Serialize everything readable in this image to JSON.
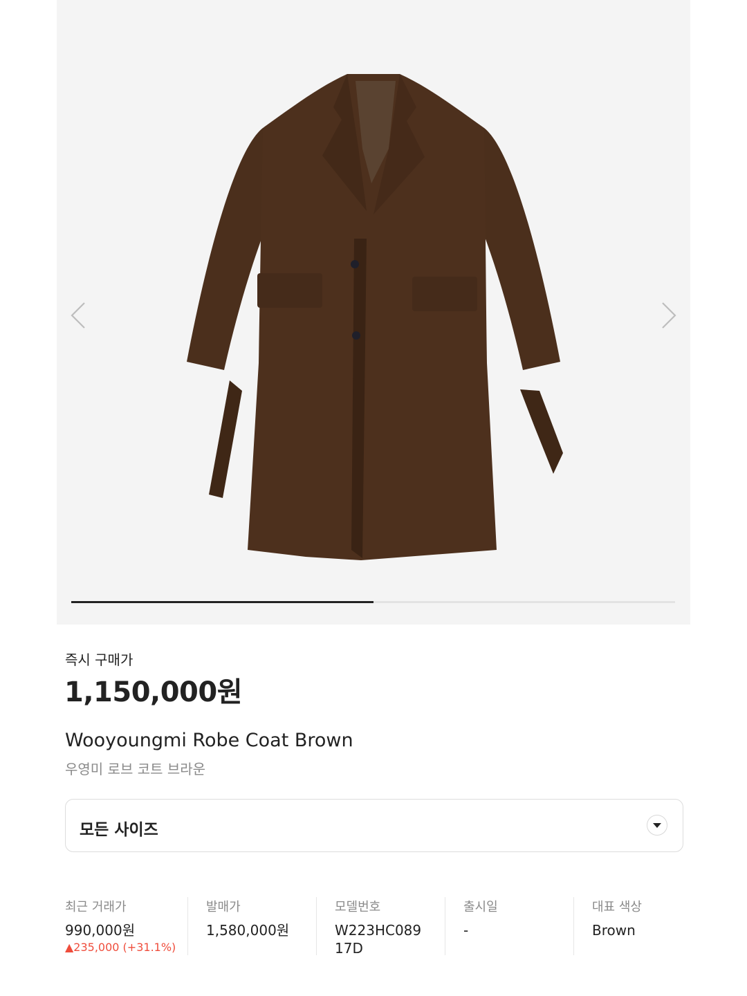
{
  "gallery": {
    "image_alt": "Wooyoungmi Robe Coat Brown product photo",
    "progress": 0.5,
    "colors": {
      "background": "#f4f4f4",
      "coat": "#4a2e1b"
    },
    "icons": {
      "prev": "chevron-left-icon",
      "next": "chevron-right-icon"
    }
  },
  "price": {
    "label": "즉시 구매가",
    "value": "1,150,000원"
  },
  "product": {
    "name": "Wooyoungmi Robe Coat Brown",
    "name_ko": "우영미 로브 코트 브라운"
  },
  "size_select": {
    "value": "모든 사이즈",
    "icon": "chevron-down-icon"
  },
  "stats": [
    {
      "label": "최근 거래가",
      "value": "990,000원",
      "change": "▲235,000 (+31.1%)"
    },
    {
      "label": "발매가",
      "value": "1,580,000원"
    },
    {
      "label": "모델번호",
      "value": "W223HC089\n17D",
      "value_line1": "W223HC089",
      "value_line2": "17D"
    },
    {
      "label": "출시일",
      "value": "-"
    },
    {
      "label": "대표 색상",
      "value": "Brown"
    }
  ],
  "colors": {
    "text": "#222222",
    "muted": "#8a8a8a",
    "up": "#ef4d3c",
    "border": "#dcdcdc"
  }
}
